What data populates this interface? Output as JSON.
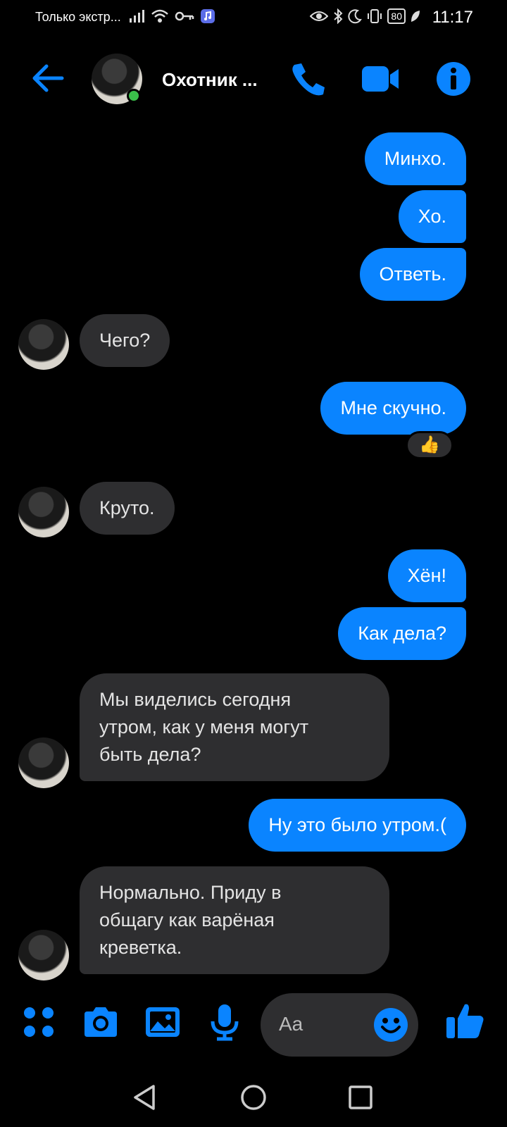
{
  "status_bar": {
    "carrier": "Только экстр...",
    "battery": "80",
    "time": "11:17"
  },
  "header": {
    "contact_name": "Охотник ..."
  },
  "messages": [
    {
      "dir": "out",
      "text": "Минхо."
    },
    {
      "dir": "out",
      "text": "Хо."
    },
    {
      "dir": "out",
      "text": "Ответь."
    },
    {
      "dir": "in",
      "text": "Чего?"
    },
    {
      "dir": "out",
      "text": "Мне скучно.",
      "reaction": "👍"
    },
    {
      "dir": "in",
      "text": "Круто."
    },
    {
      "dir": "out",
      "text": "Хён!"
    },
    {
      "dir": "out",
      "text": "Как дела?"
    },
    {
      "dir": "in",
      "lines": [
        "Мы виделись сегодня",
        "утром, как у меня могут",
        "быть дела?"
      ]
    },
    {
      "dir": "out",
      "text": "Ну это было утром.("
    },
    {
      "dir": "in",
      "lines": [
        "Нормально. Приду в",
        "общагу как варёная",
        "креветка."
      ]
    }
  ],
  "composer": {
    "placeholder": "Aa"
  },
  "colors": {
    "accent": "#0a84ff",
    "incoming": "#2e2e30",
    "online": "#3ac04a"
  }
}
